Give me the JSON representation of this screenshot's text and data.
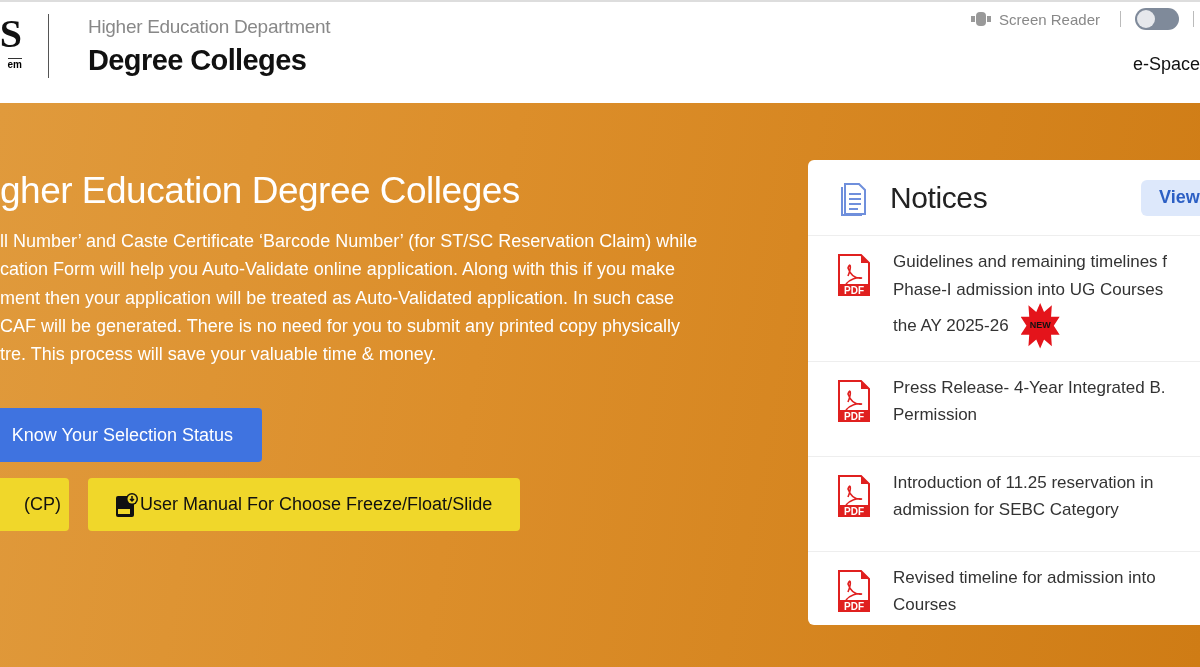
{
  "header": {
    "logo_letter": "S",
    "logo_sub": "em",
    "department": "Higher Education Department",
    "title": "Degree Colleges",
    "screen_reader": {
      "label": "Screen Reader",
      "on": false
    },
    "e_space": "e-Space"
  },
  "hero": {
    "title": "gher Education Degree Colleges",
    "paragraph_lines": [
      "ll Number’ and Caste Certificate ‘Barcode Number’ (for ST/SC Reservation Claim) while",
      "cation Form will help you Auto-Validate online application. Along with this if you make",
      "ment then your application will be treated as Auto-Validated application. In such case",
      "CAF will be generated. There is no need for you to submit any printed copy physically",
      "tre. This process will save your valuable time & money."
    ],
    "buttons": [
      {
        "label": "Know Your Selection Status",
        "kind": "primary"
      },
      {
        "label": "(CP)",
        "kind": "yellow"
      },
      {
        "label": "User Manual For Choose Freeze/Float/Slide",
        "kind": "yellow-pdf"
      }
    ]
  },
  "notices": {
    "title": "Notices",
    "view_button": "View",
    "items": [
      {
        "icon_label": "PDF",
        "lines": [
          "Guidelines and remaining timelines f",
          "Phase-I admission into UG Courses",
          "the AY 2025-26"
        ],
        "badge": "NEW"
      },
      {
        "icon_label": "PDF",
        "lines": [
          "Press Release- 4-Year Integrated B.",
          "Permission"
        ]
      },
      {
        "icon_label": "PDF",
        "lines": [
          "Introduction of 11.25 reservation in",
          "admission for SEBC Category"
        ]
      },
      {
        "icon_label": "PDF",
        "lines": [
          "Revised timeline for admission into",
          "Courses"
        ]
      }
    ]
  }
}
